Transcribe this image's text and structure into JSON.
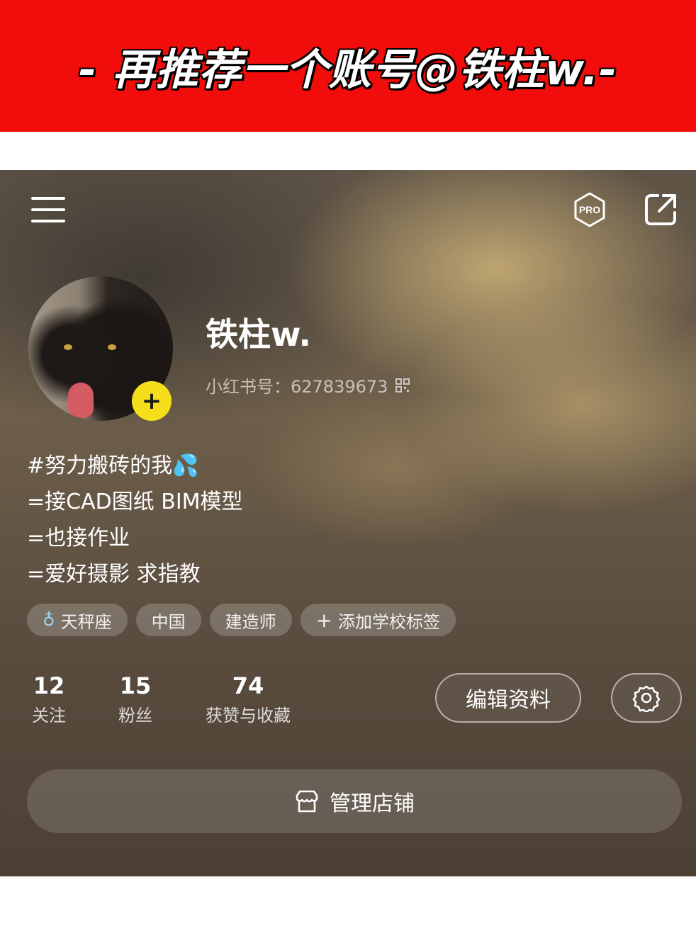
{
  "banner": {
    "text": "- 再推荐一个账号@铁柱w.-"
  },
  "header": {
    "menu_icon": "menu-icon",
    "pro_label": "PRO",
    "share_icon": "share-icon"
  },
  "profile": {
    "username": "铁柱w.",
    "account_id": "小红书号：627839673",
    "add_badge": "+",
    "bio": [
      "#努力搬砖的我💦",
      "=接CAD图纸 BIM模型",
      "=也接作业",
      "=爱好摄影 求指教"
    ],
    "tags": [
      {
        "icon": "♁",
        "label": "天秤座"
      },
      {
        "icon": "",
        "label": "中国"
      },
      {
        "icon": "",
        "label": "建造师"
      },
      {
        "icon": "+",
        "label": "添加学校标签"
      }
    ]
  },
  "stats": [
    {
      "value": "12",
      "label": "关注"
    },
    {
      "value": "15",
      "label": "粉丝"
    },
    {
      "value": "74",
      "label": "获赞与收藏"
    }
  ],
  "actions": {
    "edit_label": "编辑资料",
    "settings_icon": "gear-icon",
    "store_label": "管理店铺",
    "store_icon": "store-icon"
  },
  "colors": {
    "banner": "#f00d0b",
    "badge": "#f5df1a"
  }
}
